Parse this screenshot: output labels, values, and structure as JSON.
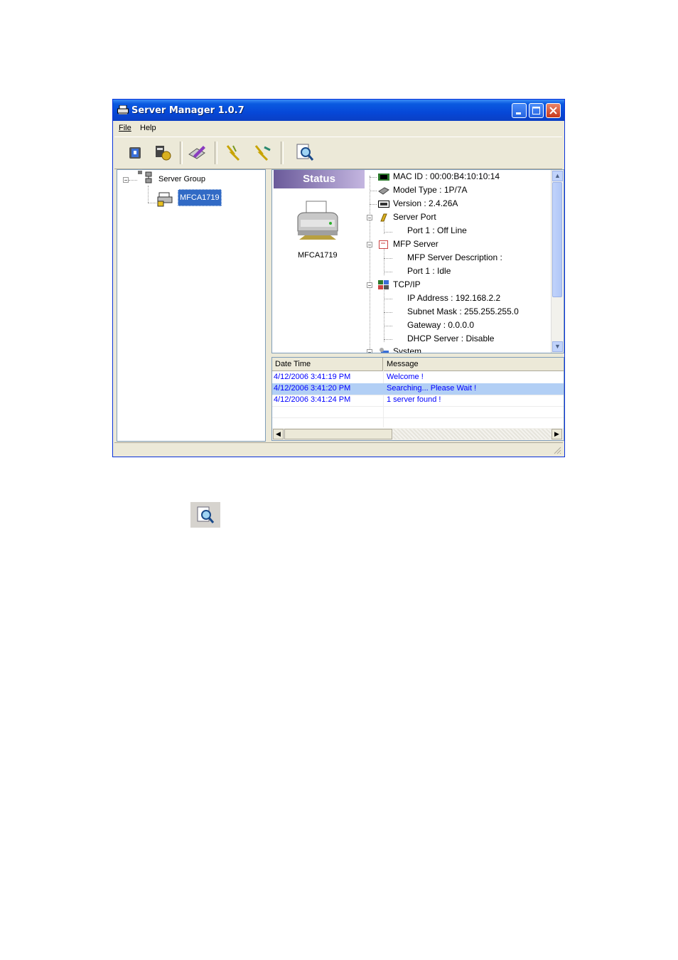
{
  "window": {
    "title": "Server Manager 1.0.7"
  },
  "menu": {
    "file": "File",
    "help": "Help"
  },
  "toolbar": {
    "buttons": [
      "server-icon",
      "config-icon",
      "edit-icon",
      "connect-icon",
      "disconnect-icon",
      "search-icon"
    ]
  },
  "tree": {
    "root": "Server Group",
    "selected": "MFCA1719"
  },
  "status": {
    "header": "Status",
    "device_name": "MFCA1719",
    "items": {
      "mac": "MAC ID : 00:00:B4:10:10:14",
      "model": "Model Type : 1P/7A",
      "version": "Version : 2.4.26A",
      "server_port": "Server Port",
      "port1_offline": "Port 1 : Off Line",
      "mfp_server": "MFP Server",
      "mfp_desc": "MFP Server Description :",
      "port1_idle": "Port 1 : Idle",
      "tcpip": "TCP/IP",
      "ip": "IP Address : 192.168.2.2",
      "subnet": "Subnet Mask : 255.255.255.0",
      "gateway": "Gateway : 0.0.0.0",
      "dhcp": "DHCP Server : Disable",
      "system": "System"
    }
  },
  "log": {
    "col_datetime": "Date Time",
    "col_message": "Message",
    "rows": [
      {
        "time": "4/12/2006 3:41:19 PM",
        "message": "Welcome !"
      },
      {
        "time": "4/12/2006 3:41:20 PM",
        "message": "Searching... Please Wait !"
      },
      {
        "time": "4/12/2006 3:41:24 PM",
        "message": "1 server found !"
      }
    ]
  },
  "colors": {
    "title_bar": "#0a5ae0",
    "status_header": "#6a5a9a",
    "log_text": "#0000ff",
    "selection": "#316ac5"
  }
}
